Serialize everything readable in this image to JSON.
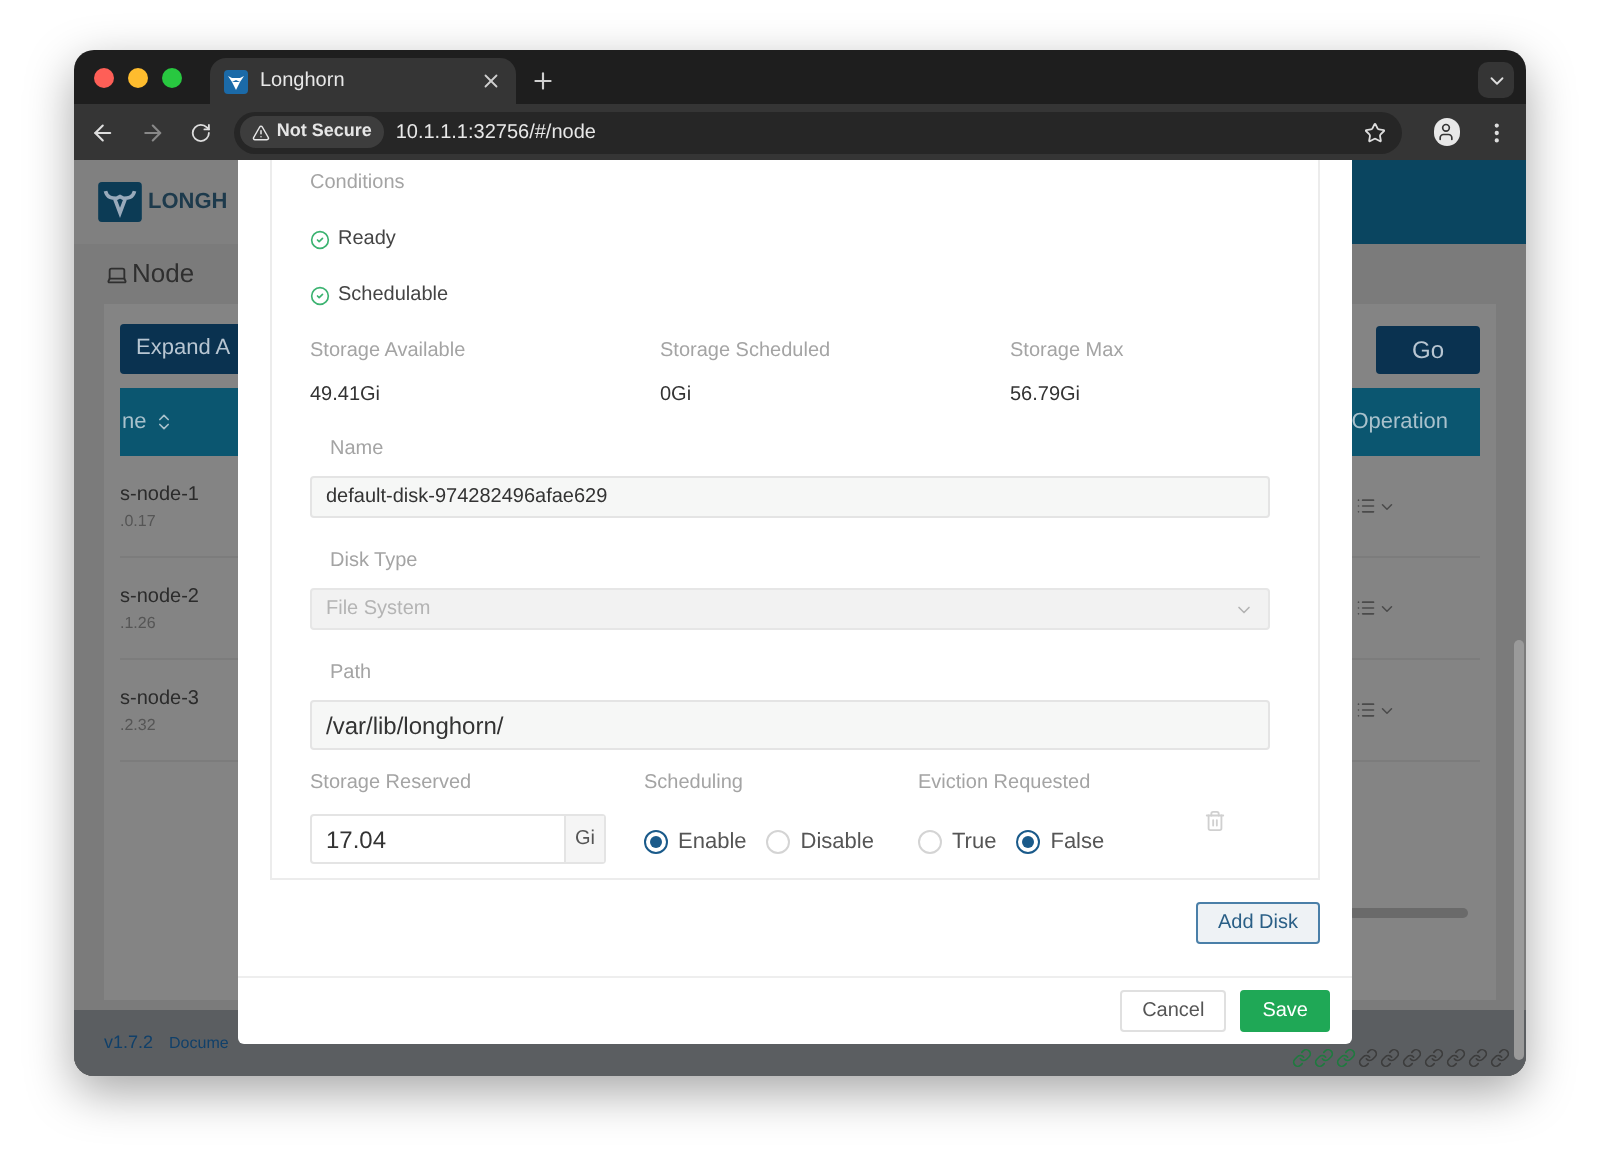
{
  "browser": {
    "tab_title": "Longhorn",
    "security": "Not Secure",
    "url": "10.1.1.1:32756/#/node"
  },
  "page": {
    "logo_text": "LONGH",
    "title": "Node",
    "expand_button": "Expand A",
    "go_button": "Go",
    "columns": [
      "ne",
      "Operation"
    ],
    "nodes": [
      {
        "name": "s-node-1",
        "ip": ".0.17"
      },
      {
        "name": "s-node-2",
        "ip": ".1.26"
      },
      {
        "name": "s-node-3",
        "ip": ".2.32"
      }
    ],
    "footer": {
      "version": "v1.7.2",
      "link": "Docume"
    }
  },
  "modal": {
    "conditions_label": "Conditions",
    "conditions": [
      {
        "label": "Ready",
        "ok": true
      },
      {
        "label": "Schedulable",
        "ok": true
      }
    ],
    "storage": [
      {
        "label": "Storage Available",
        "value": "49.41Gi"
      },
      {
        "label": "Storage Scheduled",
        "value": "0Gi"
      },
      {
        "label": "Storage Max",
        "value": "56.79Gi"
      }
    ],
    "disk": {
      "name_label": "Name",
      "name": "default-disk-974282496afae629",
      "type_label": "Disk Type",
      "type": "File System",
      "type_disabled": true,
      "path_label": "Path",
      "path": "/var/lib/longhorn/",
      "reserved_label": "Storage Reserved",
      "reserved": "17.04",
      "unit": "Gi",
      "scheduling_label": "Scheduling",
      "scheduling": [
        {
          "label": "Enable",
          "selected": true
        },
        {
          "label": "Disable",
          "selected": false
        }
      ],
      "eviction_label": "Eviction Requested",
      "eviction": [
        {
          "label": "True",
          "selected": false
        },
        {
          "label": "False",
          "selected": true
        }
      ]
    },
    "add_disk": "Add Disk",
    "buttons": [
      {
        "label": "Cancel",
        "kind": "default"
      },
      {
        "label": "Save",
        "kind": "primary"
      }
    ]
  }
}
